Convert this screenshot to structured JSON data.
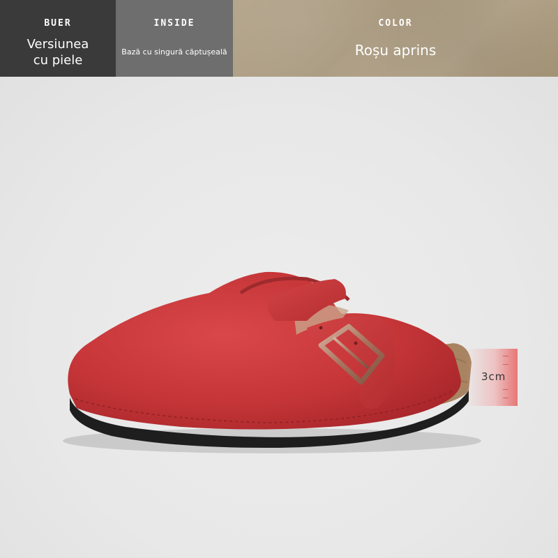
{
  "attributes": {
    "outer": {
      "label": "BUER",
      "value_line1": "Versiunea",
      "value_line2": "cu piele"
    },
    "inside": {
      "label": "INSIDE",
      "value": "Bază cu singură căptușeală"
    },
    "color": {
      "label": "COLOR",
      "value": "Roșu aprins"
    }
  },
  "product": {
    "subject": "red suede clog with buckle strap",
    "sole_height_label": "3cm"
  },
  "colors": {
    "suede_red": "#c8383a",
    "sole_black": "#1e1e1e",
    "cork": "#a98462",
    "buckle": "#b88a74",
    "swatch": "#ab9c82"
  }
}
